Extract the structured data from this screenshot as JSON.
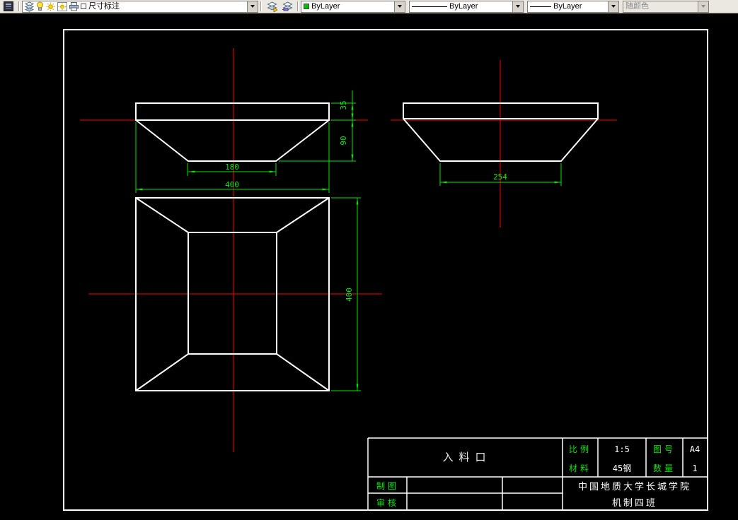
{
  "toolbar": {
    "layer_name": "尺寸标注",
    "color_value": "ByLayer",
    "linetype_value": "ByLayer",
    "lineweight_value": "ByLayer",
    "plot_style_value": "随颜色"
  },
  "drawing": {
    "dims": {
      "front_inner_width": "180",
      "front_outer_width": "400",
      "front_lip_height": "35",
      "front_total_height": "90",
      "side_bottom_width": "254",
      "top_view_height": "400"
    },
    "title_block": {
      "part_name": "入料口",
      "scale_label": "比例",
      "scale_value": "1:5",
      "drawing_no_label": "图号",
      "drawing_no_value": "A4",
      "material_label": "材料",
      "material_value": "45钢",
      "quantity_label": "数量",
      "quantity_value": "1",
      "drafter_label": "制图",
      "checker_label": "审核",
      "school_name": "中国地质大学长城学院",
      "class_name": "机制四班"
    },
    "colors": {
      "object_lines": "#ffffff",
      "dimensions": "#00e800",
      "centerlines": "#ff0000",
      "canvas_background": "#000000"
    }
  }
}
